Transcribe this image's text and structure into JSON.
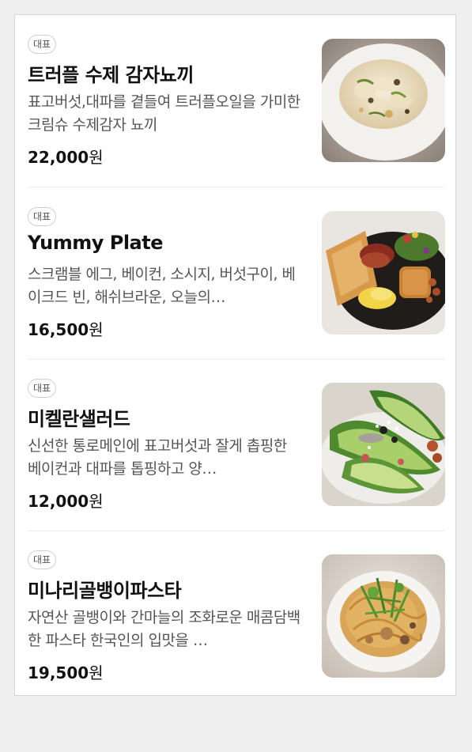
{
  "menu": {
    "items": [
      {
        "badge": "대표",
        "name": "트러플 수제 감자뇨끼",
        "description": "표고버섯,대파를 곁들여 트러플오일을 가미한 크림슈 수제감자 뇨끼",
        "price": "22,000",
        "currency": "원",
        "image": "gnocchi-photo"
      },
      {
        "badge": "대표",
        "name": "Yummy Plate",
        "description": "스크램블 에그, 베이컨, 소시지, 버섯구이, 베이크드 빈, 해쉬브라운, 오늘의…",
        "price": "16,500",
        "currency": "원",
        "image": "breakfast-plate-photo"
      },
      {
        "badge": "대표",
        "name": "미켈란샐러드",
        "description": "신선한 통로메인에 표고버섯과 잘게 촙핑한 베이컨과 대파를 톱핑하고 양…",
        "price": "12,000",
        "currency": "원",
        "image": "salad-photo"
      },
      {
        "badge": "대표",
        "name": "미나리골뱅이파스타",
        "description": "자연산 골뱅이와 간마늘의 조화로운 매콤담백한 파스타 한국인의 입맛을 …",
        "price": "19,500",
        "currency": "원",
        "image": "pasta-photo"
      }
    ]
  }
}
